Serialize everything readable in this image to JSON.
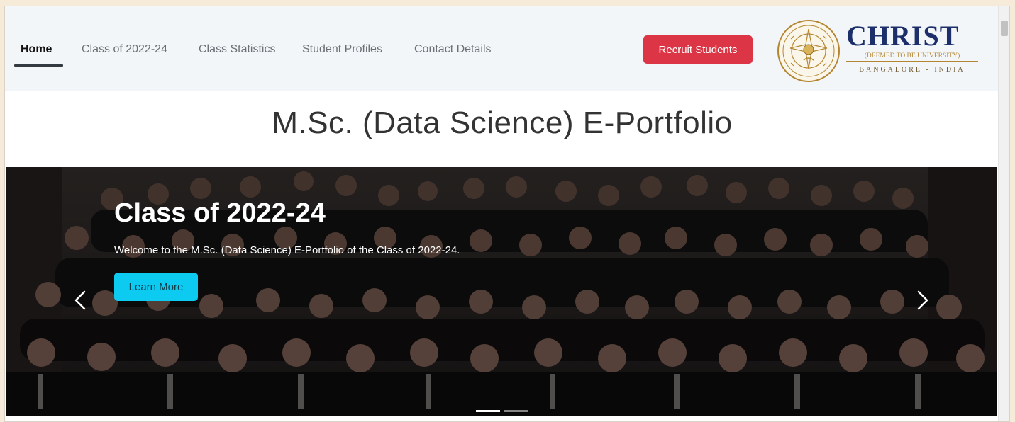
{
  "navbar": {
    "items": [
      {
        "label": "Home",
        "active": true
      },
      {
        "label": "Class of 2022-24",
        "active": false
      },
      {
        "label": "Class Statistics",
        "active": false
      },
      {
        "label": "Student Profiles",
        "active": false
      },
      {
        "label": "Contact Details",
        "active": false
      }
    ],
    "recruit_label": "Recruit Students"
  },
  "logo": {
    "name": "CHRIST",
    "subtitle": "(DEEMED TO BE UNIVERSITY)",
    "city": "BANGALORE - INDIA"
  },
  "page": {
    "title": "M.Sc. (Data Science) E-Portfolio"
  },
  "hero": {
    "heading": "Class of 2022-24",
    "text": "Welcome to the M.Sc. (Data Science) E-Portfolio of the Class of 2022-24.",
    "button_label": "Learn More",
    "slides_count": 2,
    "active_slide": 1,
    "prev_icon": "chevron-left-icon",
    "next_icon": "chevron-right-icon"
  },
  "colors": {
    "recruit_button": "#dc3545",
    "learn_button": "#0dcaf0",
    "logo_navy": "#1d2f6b",
    "logo_gold": "#b48632"
  }
}
